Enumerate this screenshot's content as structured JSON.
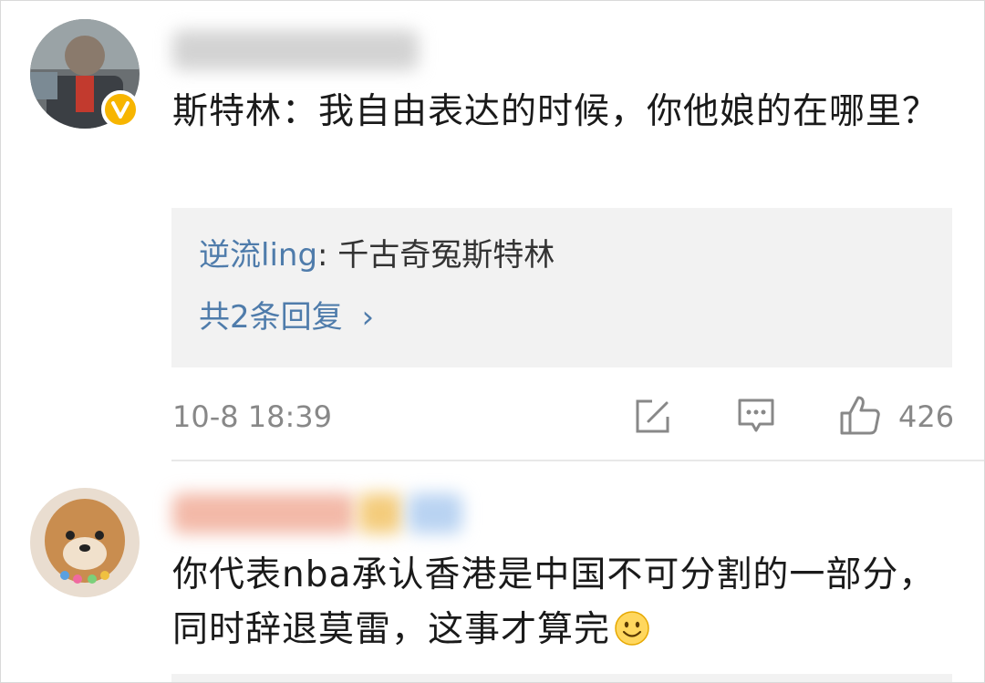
{
  "comments": [
    {
      "text": "斯特林：我自由表达的时候，你他娘的在哪里？",
      "reply": {
        "user": "逆流ling",
        "separator": ": ",
        "text": "千古奇冤斯特林",
        "more_label": "共2条回复",
        "more_chevron": "›"
      },
      "time": "10-8 18:39",
      "actions": {
        "repost_icon": "edit-share-icon",
        "comment_icon": "chat-bubble-icon",
        "like_icon": "thumbs-up-icon",
        "like_count": "426"
      },
      "verified_badge": "v-verified-icon",
      "verified_color": "#f7b500"
    },
    {
      "text": "你代表nba承认香港是中国不可分割的一部分，同时辞退莫雷，这事才算完",
      "emoji": "smile-emoji-icon"
    }
  ],
  "colors": {
    "link_blue": "#4f7cab",
    "meta_gray": "#888888",
    "reply_bg": "#f2f2f2"
  }
}
